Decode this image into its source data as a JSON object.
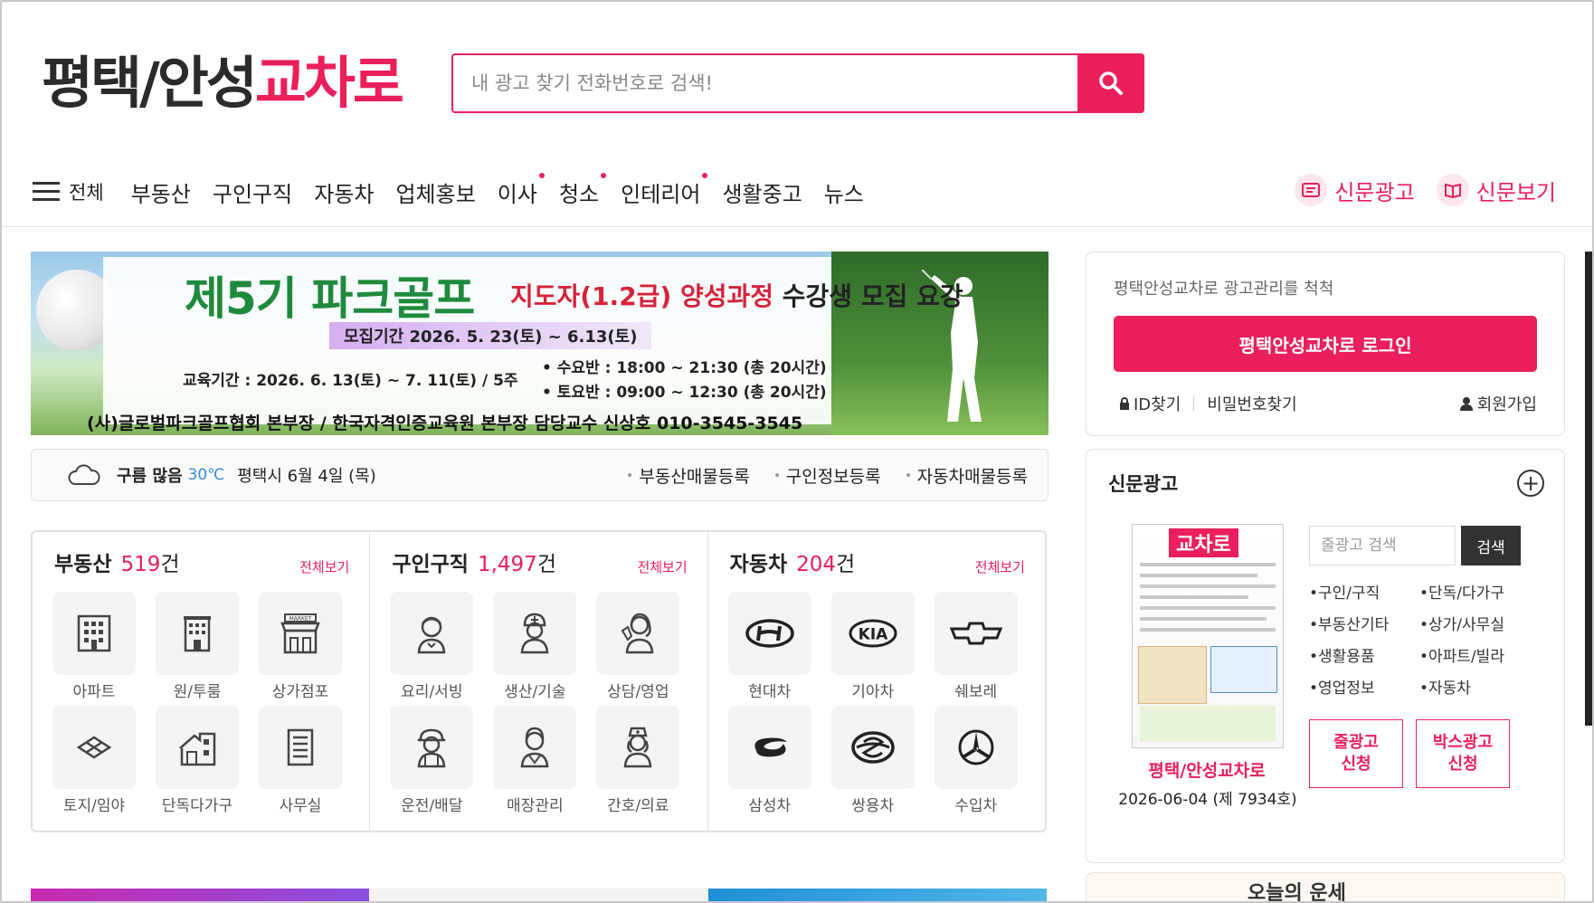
{
  "logo": {
    "part1": "평택/안성",
    "part2": "교차로"
  },
  "search": {
    "placeholder": "내 광고 찾기 전화번호로 검색!"
  },
  "nav": {
    "all_label": "전체",
    "items": [
      {
        "label": "부동산",
        "dot": false
      },
      {
        "label": "구인구직",
        "dot": false
      },
      {
        "label": "자동차",
        "dot": false
      },
      {
        "label": "업체홍보",
        "dot": false
      },
      {
        "label": "이사",
        "dot": true
      },
      {
        "label": "청소",
        "dot": true
      },
      {
        "label": "인테리어",
        "dot": true
      },
      {
        "label": "생활중고",
        "dot": false
      },
      {
        "label": "뉴스",
        "dot": false
      }
    ],
    "right": [
      {
        "label": "신문광고",
        "icon": "newspaper-icon"
      },
      {
        "label": "신문보기",
        "icon": "book-icon"
      }
    ]
  },
  "banner": {
    "title": "제5기 파크골프",
    "subtitle": "지도자(1.2급) 양성과정",
    "subtitle2": "수강생 모집 요강",
    "period": "모집기간 2026. 5. 23(토) ~ 6.13(토)",
    "edu": "교육기간 : 2026. 6. 13(토) ~ 7. 11(토) / 5주",
    "class1": "• 수요반 : 18:00 ~ 21:30 (총 20시간)",
    "class2": "• 토요반 : 09:00 ~ 12:30 (총 20시간)",
    "footer": "(사)글로벌파크골프협회 본부장  /  한국자격인증교육원 본부장  담당교수  신상호  010-3545-3545"
  },
  "weather": {
    "condition": "구름 많음",
    "temp": "30℃",
    "place": "평택시 6월 4일 (목)",
    "links": [
      "부동산매물등록",
      "구인정보등록",
      "자동차매물등록"
    ]
  },
  "categories": [
    {
      "title": "부동산",
      "count": "519",
      "unit": "건",
      "more": "전체보기",
      "items": [
        {
          "label": "아파트",
          "icon": "apartment-icon"
        },
        {
          "label": "원/투룸",
          "icon": "building-icon"
        },
        {
          "label": "상가점포",
          "icon": "market-icon"
        },
        {
          "label": "토지/임야",
          "icon": "land-icon"
        },
        {
          "label": "단독다가구",
          "icon": "house-icon"
        },
        {
          "label": "사무실",
          "icon": "office-icon"
        }
      ]
    },
    {
      "title": "구인구직",
      "count": "1,497",
      "unit": "건",
      "more": "전체보기",
      "items": [
        {
          "label": "요리/서빙",
          "icon": "cook-icon"
        },
        {
          "label": "생산/기술",
          "icon": "worker-icon"
        },
        {
          "label": "상담/영업",
          "icon": "consultant-icon"
        },
        {
          "label": "운전/배달",
          "icon": "driver-icon"
        },
        {
          "label": "매장관리",
          "icon": "staff-icon"
        },
        {
          "label": "간호/의료",
          "icon": "nurse-icon"
        }
      ]
    },
    {
      "title": "자동차",
      "count": "204",
      "unit": "건",
      "more": "전체보기",
      "items": [
        {
          "label": "현대차",
          "icon": "hyundai-icon"
        },
        {
          "label": "기아차",
          "icon": "kia-icon"
        },
        {
          "label": "쉐보레",
          "icon": "chevrolet-icon"
        },
        {
          "label": "삼성차",
          "icon": "samsung-icon"
        },
        {
          "label": "쌍용차",
          "icon": "ssangyong-icon"
        },
        {
          "label": "수입차",
          "icon": "import-car-icon"
        }
      ]
    }
  ],
  "login": {
    "tagline": "평택안성교차로 광고관리를 척척",
    "button": "평택안성교차로 로그인",
    "find_id": "ID찾기",
    "find_pw": "비밀번호찾기",
    "join": "회원가입"
  },
  "newspaper": {
    "title": "신문광고",
    "paper_name": "평택/안성교차로",
    "paper_date": "2026-06-04 (제 7934호)",
    "thumb_logo": "교차로",
    "search_placeholder": "줄광고 검색",
    "search_button": "검색",
    "categories": [
      "•구인/구직",
      "•단독/다가구",
      "•부동산기타",
      "•상가/사무실",
      "•생활용품",
      "•아파트/빌라",
      "•영업정보",
      "•자동차"
    ],
    "apply1": "줄광고\n신청",
    "apply2": "박스광고\n신청"
  },
  "fortune": {
    "title": "오늘의 운세"
  },
  "colors": {
    "accent": "#ea1f5c",
    "temp": "#3a8fd9"
  }
}
